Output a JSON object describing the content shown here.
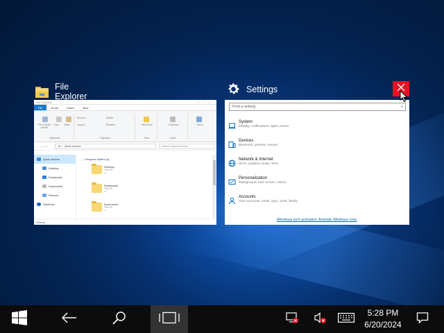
{
  "task_view": {
    "windows": [
      {
        "app": "File Explorer",
        "thumbnail": {
          "title_bar": "File Explorer",
          "tabs": [
            "File",
            "Home",
            "Share",
            "View"
          ],
          "ribbon_groups": [
            "Clipboard",
            "Organize",
            "New",
            "Open",
            "Select"
          ],
          "ribbon_items": {
            "pin": "Pin to Quick access",
            "copy": "Copy",
            "paste": "Paste",
            "move_to": "Move to",
            "copy_to": "Copy to",
            "delete": "Delete",
            "rename": "Rename",
            "new_folder": "New folder",
            "properties": "Properties",
            "select": "Select"
          },
          "address": "Quick access",
          "search_placeholder": "Search Quick access",
          "nav": [
            "Quick access",
            "Desktop",
            "Downloads",
            "Documents",
            "Pictures",
            "OneDrive"
          ],
          "frequent_header": "Frequent folders (4)",
          "folders": [
            {
              "name": "Desktop",
              "location": "This PC"
            },
            {
              "name": "Downloads",
              "location": "This PC"
            },
            {
              "name": "Documents",
              "location": "This PC"
            }
          ],
          "status": "4 items"
        }
      },
      {
        "app": "Settings",
        "thumbnail": {
          "search_placeholder": "Find a setting",
          "items": [
            {
              "title": "System",
              "subtitle": "Display, notifications, apps, power"
            },
            {
              "title": "Devices",
              "subtitle": "Bluetooth, printers, mouse"
            },
            {
              "title": "Network & Internet",
              "subtitle": "Wi-Fi, airplane mode, VPN"
            },
            {
              "title": "Personalization",
              "subtitle": "Background, lock screen, colors"
            },
            {
              "title": "Accounts",
              "subtitle": "Your accounts, email, sync, work, family"
            }
          ],
          "activation_link": "Windows isn't activated. Activate Windows now."
        }
      }
    ]
  },
  "taskbar": {
    "time": "5:28 PM",
    "date": "6/20/2024"
  },
  "colors": {
    "close_red": "#e81123",
    "taskbar": "#0c0c0c",
    "accent_blue": "#1979ca",
    "link_blue": "#0067b8"
  },
  "icons": [
    "windows-start-icon",
    "back-arrow-icon",
    "search-icon",
    "task-view-icon",
    "network-disconnected-icon",
    "volume-muted-icon",
    "keyboard-icon",
    "action-center-icon",
    "folder-icon",
    "gear-icon",
    "close-icon"
  ]
}
